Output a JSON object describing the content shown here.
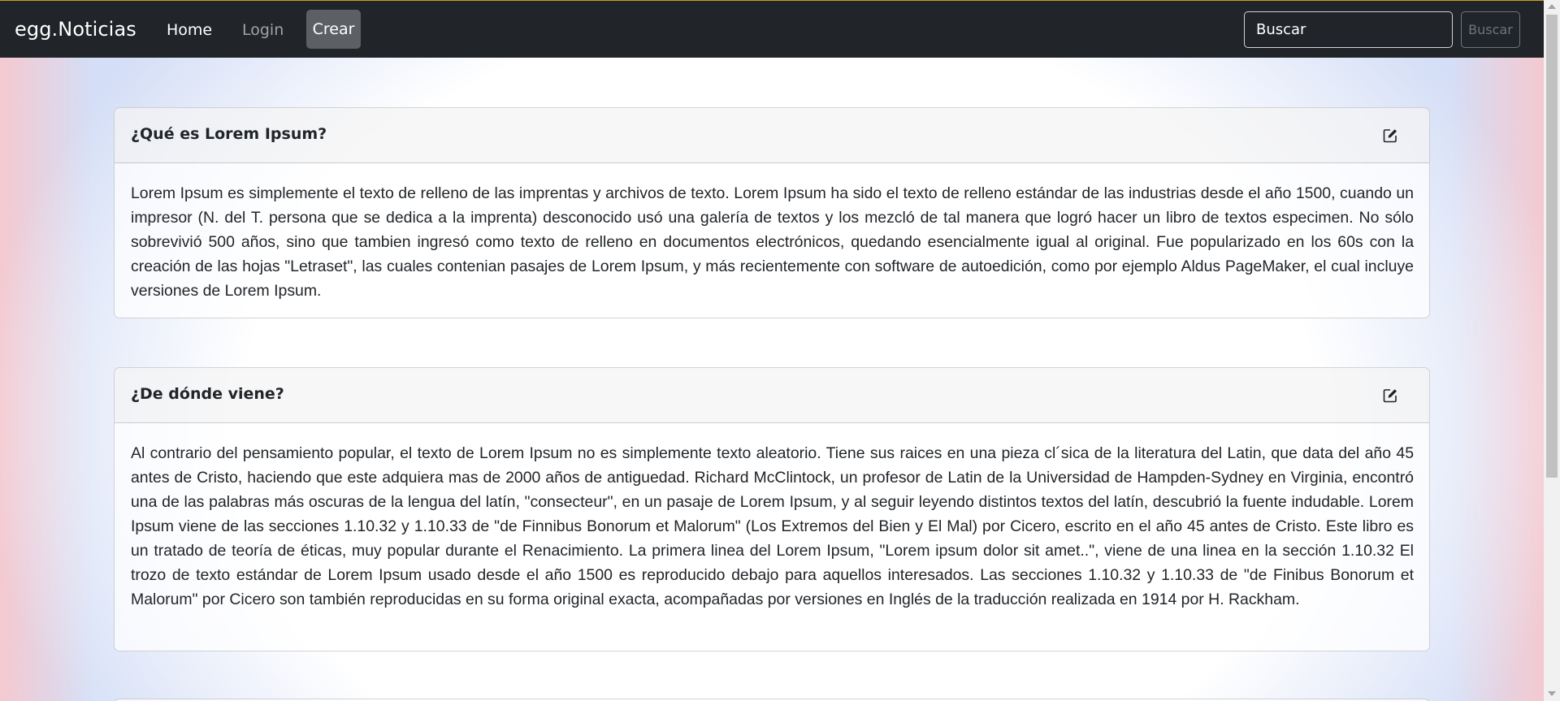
{
  "navbar": {
    "brand": "egg.Noticias",
    "links": [
      {
        "label": "Home",
        "active": true
      },
      {
        "label": "Login",
        "active": false
      },
      {
        "label": "Crear",
        "active": false
      }
    ],
    "search": {
      "placeholder": "Buscar",
      "button_label": "Buscar"
    }
  },
  "colors": {
    "navbar_bg": "#212529",
    "active_button_bg": "#5c6065",
    "text": "#212529"
  },
  "icons": {
    "edit": "edit-square-icon"
  },
  "posts": [
    {
      "title": "¿Qué es Lorem Ipsum?",
      "body": "Lorem Ipsum es simplemente el texto de relleno de las imprentas y archivos de texto. Lorem Ipsum ha sido el texto de relleno estándar de las industrias desde el año 1500, cuando un impresor (N. del T. persona que se dedica a la imprenta) desconocido usó una galería de textos y los mezcló de tal manera que logró hacer un libro de textos especimen. No sólo sobrevivió 500 años, sino que tambien ingresó como texto de relleno en documentos electrónicos, quedando esencialmente igual al original. Fue popularizado en los 60s con la creación de las hojas \"Letraset\", las cuales contenian pasajes de Lorem Ipsum, y más recientemente con software de autoedición, como por ejemplo Aldus PageMaker, el cual incluye versiones de Lorem Ipsum."
    },
    {
      "title": "¿De dónde viene?",
      "body": "Al contrario del pensamiento popular, el texto de Lorem Ipsum no es simplemente texto aleatorio. Tiene sus raices en una pieza cl´sica de la literatura del Latin, que data del año 45 antes de Cristo, haciendo que este adquiera mas de 2000 años de antiguedad. Richard McClintock, un profesor de Latin de la Universidad de Hampden-Sydney en Virginia, encontró una de las palabras más oscuras de la lengua del latín, \"consecteur\", en un pasaje de Lorem Ipsum, y al seguir leyendo distintos textos del latín, descubrió la fuente indudable. Lorem Ipsum viene de las secciones 1.10.32 y 1.10.33 de \"de Finnibus Bonorum et Malorum\" (Los Extremos del Bien y El Mal) por Cicero, escrito en el año 45 antes de Cristo. Este libro es un tratado de teoría de éticas, muy popular durante el Renacimiento. La primera linea del Lorem Ipsum, \"Lorem ipsum dolor sit amet..\", viene de una linea en la sección 1.10.32 El trozo de texto estándar de Lorem Ipsum usado desde el año 1500 es reproducido debajo para aquellos interesados. Las secciones 1.10.32 y 1.10.33 de \"de Finibus Bonorum et Malorum\" por Cicero son también reproducidas en su forma original exacta, acompañadas por versiones en Inglés de la traducción realizada en 1914 por H. Rackham."
    }
  ]
}
